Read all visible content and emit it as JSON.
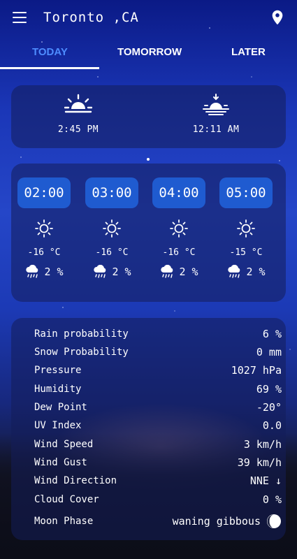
{
  "header": {
    "city": "Toronto ,CA",
    "menu_icon": "menu-icon",
    "location_icon": "location-pin-icon"
  },
  "tabs": [
    {
      "label": "TODAY",
      "active": true
    },
    {
      "label": "TOMORROW",
      "active": false
    },
    {
      "label": "LATER",
      "active": false
    }
  ],
  "sun": {
    "sunrise": {
      "time": "2:45 PM",
      "icon": "sunrise-icon"
    },
    "sunset": {
      "time": "12:11 AM",
      "icon": "sunset-icon"
    }
  },
  "hourly": [
    {
      "time": "02:00",
      "temp": "-16 °C",
      "precip": "2 %",
      "icon": "sun-icon"
    },
    {
      "time": "03:00",
      "temp": "-16 °C",
      "precip": "2 %",
      "icon": "sun-icon"
    },
    {
      "time": "04:00",
      "temp": "-16 °C",
      "precip": "2 %",
      "icon": "sun-icon"
    },
    {
      "time": "05:00",
      "temp": "-15 °C",
      "precip": "2 %",
      "icon": "sun-icon"
    }
  ],
  "details": [
    {
      "label": "Rain probability",
      "value": "6 %"
    },
    {
      "label": "Snow Probability",
      "value": "0 mm"
    },
    {
      "label": "Pressure",
      "value": "1027 hPa"
    },
    {
      "label": "Humidity",
      "value": "69 %"
    },
    {
      "label": "Dew Point",
      "value": "-20°"
    },
    {
      "label": "UV Index",
      "value": "0.0"
    },
    {
      "label": "Wind Speed",
      "value": "3 km/h"
    },
    {
      "label": "Wind Gust",
      "value": "39 km/h"
    },
    {
      "label": "Wind Direction",
      "value": "NNE ↓"
    },
    {
      "label": "Cloud Cover",
      "value": "0 %"
    }
  ],
  "moon": {
    "label": "Moon Phase",
    "value": "waning gibbous",
    "icon": "moon-icon"
  },
  "colors": {
    "accent": "#4d8cff",
    "pill": "#1f5bd0"
  }
}
